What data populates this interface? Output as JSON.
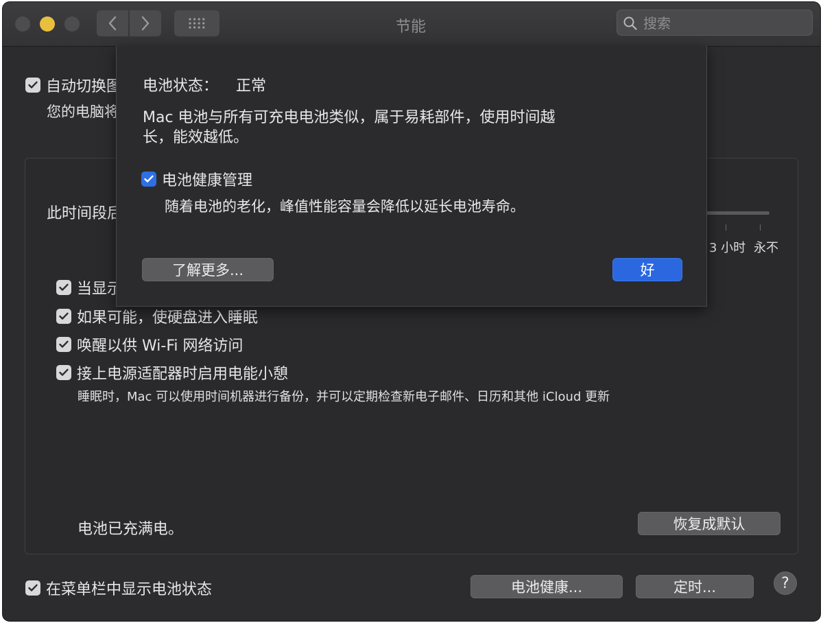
{
  "window": {
    "title": "节能"
  },
  "search": {
    "placeholder": "搜索"
  },
  "main": {
    "auto_switch_label": "自动切换图",
    "auto_switch_sub": "您的电脑将",
    "period_label": "此时间段后",
    "slider_ticks": [
      "3 小时",
      "永不"
    ],
    "option1_label": "当显示",
    "options": [
      {
        "label": "如果可能，使硬盘进入睡眠",
        "checked": true
      },
      {
        "label": "唤醒以供 Wi-Fi 网络访问",
        "checked": true
      },
      {
        "label": "接上电源适配器时启用电能小憩",
        "checked": true
      }
    ],
    "power_nap_description": "睡眠时，Mac 可以使用时间机器进行备份，并可以定期检查新电子邮件、日历和其他 iCloud 更新",
    "battery_status": "电池已充满电。",
    "restore_defaults": "恢复成默认"
  },
  "bottom": {
    "show_battery_label": "在菜单栏中显示电池状态",
    "battery_health_button": "电池健康...",
    "schedule_button": "定时...",
    "help": "?"
  },
  "sheet": {
    "status_label": "电池状态：",
    "status_value": "正常",
    "description_line1": "Mac 电池与所有可充电电池类似，属于易耗部件，使用时间越",
    "description_line2": "长，能效越低。",
    "management_label": "电池健康管理",
    "management_sub": "随着电池的老化，峰值性能容量会降低以延长电池寿命。",
    "learn_more": "了解更多...",
    "ok": "好"
  },
  "colors": {
    "accent": "#2b68e0",
    "window_bg": "#2c2c2e"
  }
}
